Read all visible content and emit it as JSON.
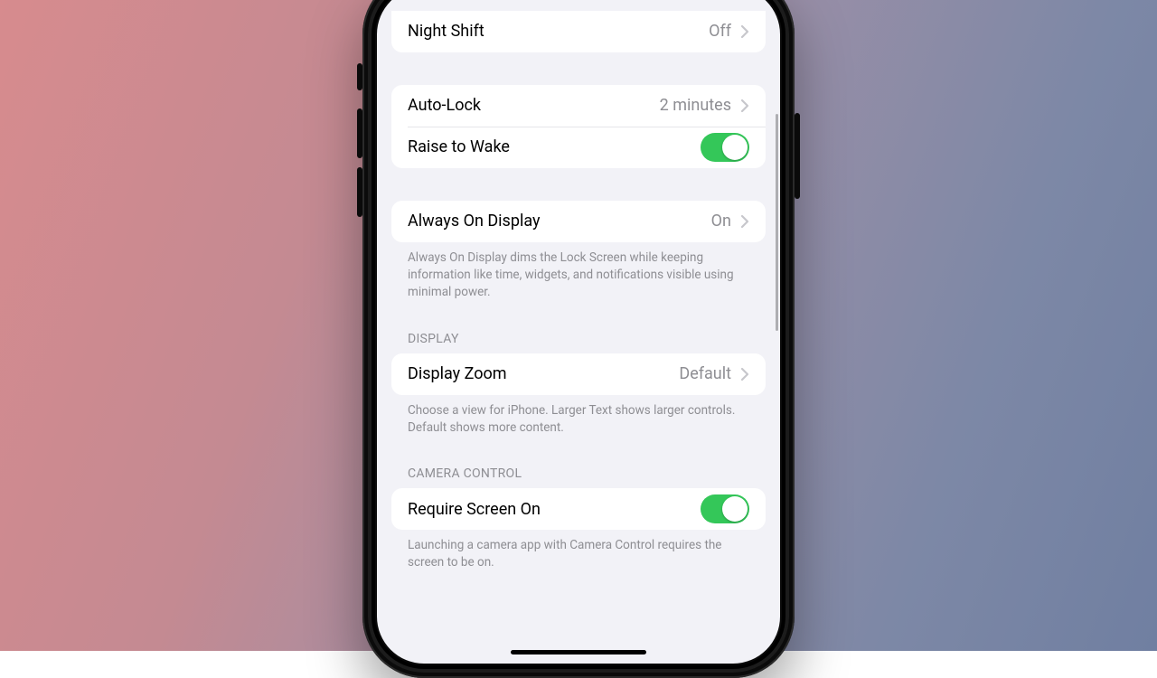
{
  "brightness": {
    "night_shift_label": "Night Shift",
    "night_shift_value": "Off"
  },
  "lock": {
    "auto_lock_label": "Auto-Lock",
    "auto_lock_value": "2 minutes",
    "raise_to_wake_label": "Raise to Wake",
    "raise_to_wake_on": true
  },
  "aod": {
    "label": "Always On Display",
    "value": "On",
    "footer": "Always On Display dims the Lock Screen while keeping information like time, widgets, and notifications visible using minimal power."
  },
  "display": {
    "header": "DISPLAY",
    "zoom_label": "Display Zoom",
    "zoom_value": "Default",
    "footer": "Choose a view for iPhone. Larger Text shows larger controls. Default shows more content."
  },
  "camera": {
    "header": "CAMERA CONTROL",
    "require_label": "Require Screen On",
    "require_on": true,
    "footer": "Launching a camera app with Camera Control requires the screen to be on."
  }
}
